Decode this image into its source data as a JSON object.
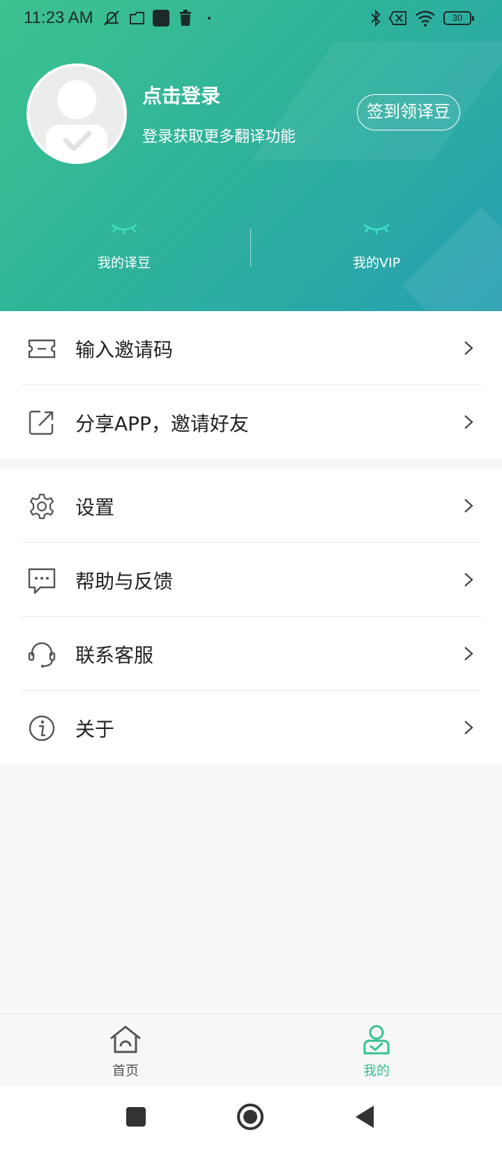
{
  "status_bar": {
    "time": "11:23 AM",
    "battery": "30",
    "icons": [
      "mute-bell-icon",
      "folder-icon",
      "app-square-icon",
      "trash-icon",
      "dot-icon",
      "bluetooth-icon",
      "no-sim-icon",
      "wifi-icon",
      "battery-icon"
    ]
  },
  "header": {
    "login_title": "点击登录",
    "login_subtitle": "登录获取更多翻译功能",
    "checkin_button": "签到领译豆",
    "stats": [
      {
        "label": "我的译豆",
        "icon": "closed-eye-icon"
      },
      {
        "label": "我的VIP",
        "icon": "closed-eye-icon"
      }
    ],
    "colors": {
      "gradient_start": "#3ec28f",
      "gradient_end": "#27a0b3"
    }
  },
  "menu": {
    "group1": [
      {
        "label": "输入邀请码",
        "icon": "ticket-icon"
      },
      {
        "label": "分享APP，邀请好友",
        "icon": "share-icon"
      }
    ],
    "group2": [
      {
        "label": "设置",
        "icon": "gear-icon"
      },
      {
        "label": "帮助与反馈",
        "icon": "chat-bubble-icon"
      },
      {
        "label": "联系客服",
        "icon": "headset-icon"
      },
      {
        "label": "关于",
        "icon": "info-icon"
      }
    ]
  },
  "tab_bar": {
    "tabs": [
      {
        "label": "首页",
        "icon": "home-icon",
        "active": false
      },
      {
        "label": "我的",
        "icon": "profile-icon",
        "active": true
      }
    ],
    "active_color": "#35c28f",
    "inactive_color": "#555555"
  },
  "nav_bar": {
    "buttons": [
      "recents-square-icon",
      "home-circle-icon",
      "back-triangle-icon"
    ]
  }
}
